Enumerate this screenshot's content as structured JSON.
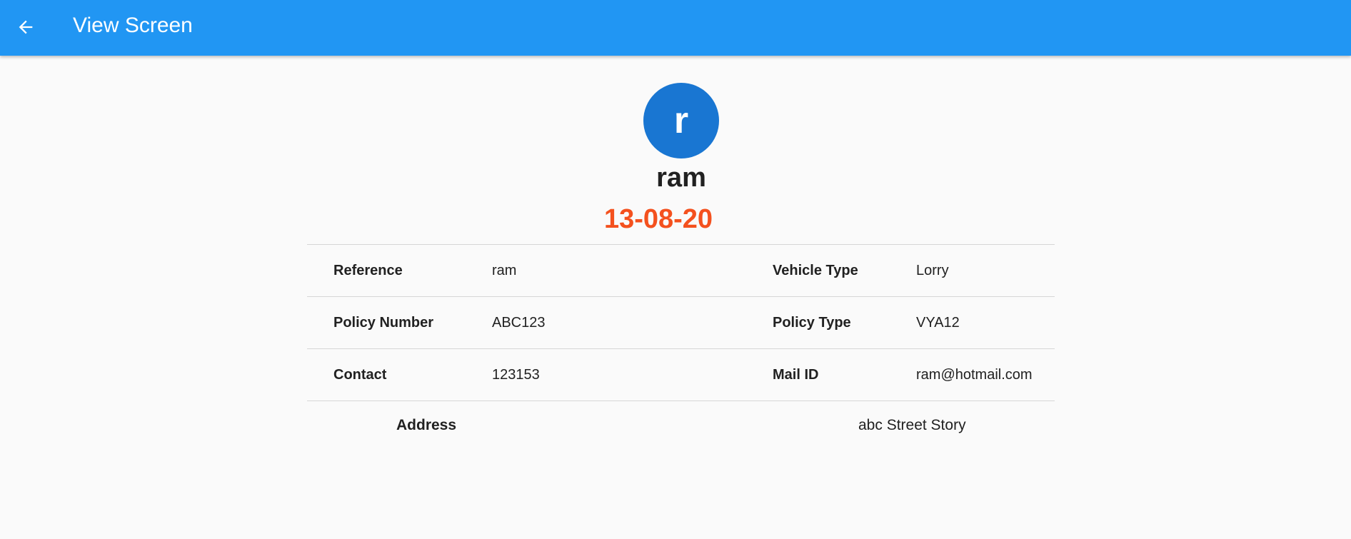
{
  "appbar": {
    "title": "View Screen",
    "back_icon": "arrow-left-icon",
    "color": "#2196f3"
  },
  "profile": {
    "avatar_letter": "r",
    "avatar_color": "#1976d2",
    "name": "ram",
    "date": "13-08-20",
    "date_color": "#f4511e"
  },
  "details": {
    "rows": [
      {
        "label1": "Reference",
        "value1": "ram",
        "label2": "Vehicle Type",
        "value2": "Lorry"
      },
      {
        "label1": "Policy Number",
        "value1": "ABC123",
        "label2": "Policy Type",
        "value2": "VYA12"
      },
      {
        "label1": "Contact",
        "value1": "123153",
        "label2": "Mail ID",
        "value2": "ram@hotmail.com"
      }
    ],
    "address": {
      "label": "Address",
      "value": "abc Street Story"
    }
  }
}
